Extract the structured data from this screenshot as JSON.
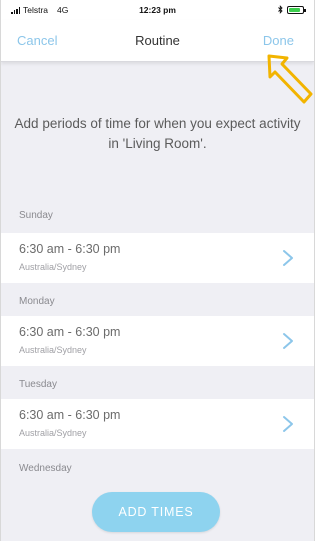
{
  "status_bar": {
    "carrier": "Telstra",
    "network": "4G",
    "time": "12:23 pm",
    "bluetooth_icon": "bluetooth-icon",
    "battery_icon": "battery-icon"
  },
  "nav": {
    "cancel_label": "Cancel",
    "title": "Routine",
    "done_label": "Done"
  },
  "intro_text": "Add periods of time for when you expect activity in 'Living Room'.",
  "days": [
    {
      "day": "Sunday",
      "time_range": "6:30 am - 6:30 pm",
      "timezone": "Australia/Sydney"
    },
    {
      "day": "Monday",
      "time_range": "6:30 am - 6:30 pm",
      "timezone": "Australia/Sydney"
    },
    {
      "day": "Tuesday",
      "time_range": "6:30 am - 6:30 pm",
      "timezone": "Australia/Sydney"
    },
    {
      "day": "Wednesday"
    }
  ],
  "add_button_label": "ADD TIMES",
  "colors": {
    "accent": "#8cc6ea",
    "button": "#8ed3ef",
    "annotation_arrow": "#f2b400",
    "background": "#efeff4"
  }
}
